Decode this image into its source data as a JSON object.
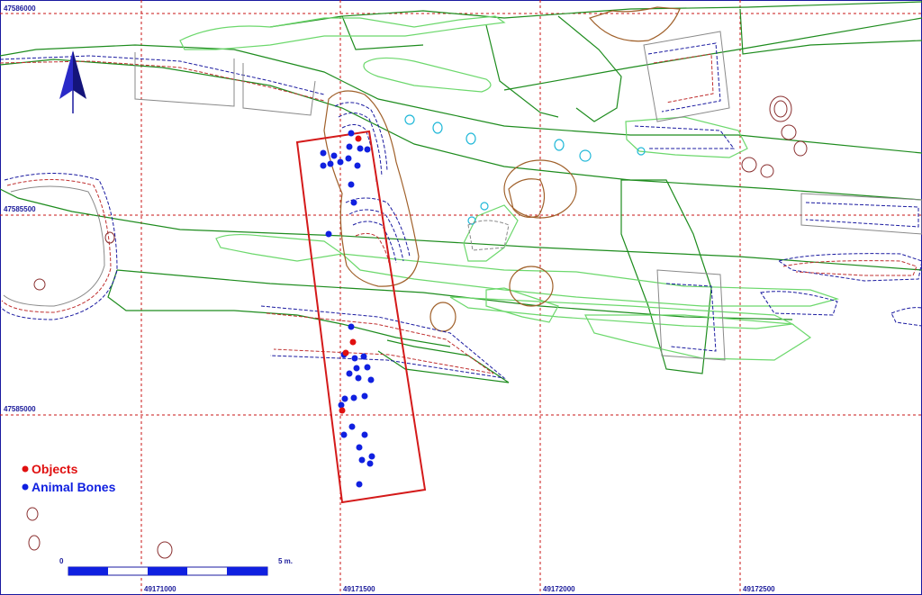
{
  "grid": {
    "top_label": "47586000",
    "mid_label": "47585500",
    "bottom_label": "47585000",
    "x_labels": [
      "49171000",
      "49171500",
      "49172000",
      "49172500"
    ]
  },
  "legend": {
    "objects_label": "Objects",
    "bones_label": "Animal Bones",
    "objects_color": "#e01010",
    "bones_color": "#1020e0"
  },
  "scale": {
    "start_label": "0",
    "end_label": "5 m."
  },
  "colors": {
    "grid": "#c81414",
    "trench": "#d41a1a",
    "ditch_dark": "#1e8c1e",
    "ditch_light": "#6cd86c",
    "pit_brown": "#a0602a",
    "posthole_cyan": "#20b8d8",
    "contour_blue": "#1a1aa0",
    "contour_red": "#c03030"
  },
  "icons": [
    "north-arrow-icon"
  ]
}
